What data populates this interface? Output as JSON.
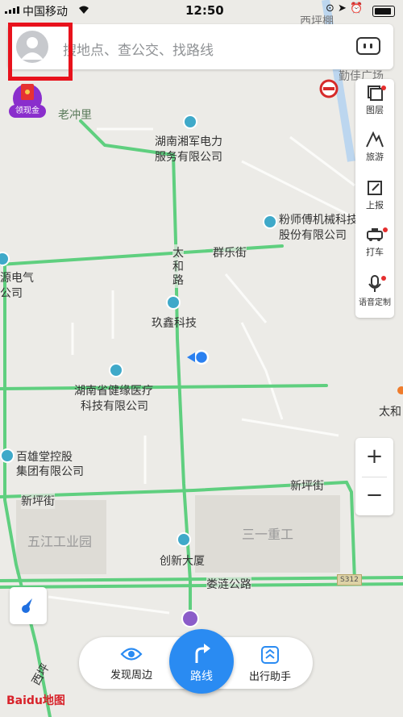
{
  "status_bar": {
    "carrier": "中国移动",
    "time": "12:50"
  },
  "search": {
    "placeholder": "搜地点、查公交、找路线"
  },
  "promo": {
    "label": "领现金"
  },
  "side_panel": {
    "items": [
      {
        "label": "图层",
        "icon": "layers-icon"
      },
      {
        "label": "旅游",
        "icon": "travel-icon"
      },
      {
        "label": "上报",
        "icon": "report-icon"
      },
      {
        "label": "打车",
        "icon": "taxi-icon"
      },
      {
        "label": "语音定制",
        "icon": "mic-icon"
      }
    ]
  },
  "zoom": {
    "in": "+",
    "out": "−"
  },
  "bottom_bar": {
    "discover": "发现周边",
    "route": "路线",
    "assistant": "出行助手"
  },
  "map": {
    "places": [
      {
        "name": "老冲里"
      },
      {
        "name": "湖南湘军电力"
      },
      {
        "name": "服务有限公司"
      },
      {
        "name": "粉师傅机械科技"
      },
      {
        "name": "股份有限公司"
      },
      {
        "name": "源电气"
      },
      {
        "name": "公司"
      },
      {
        "name": "玖鑫科技"
      },
      {
        "name": "湖南省健缘医疗"
      },
      {
        "name": "科技有限公司"
      },
      {
        "name": "百雄堂控股"
      },
      {
        "name": "集团有限公司"
      },
      {
        "name": "五江工业园"
      },
      {
        "name": "三一重工"
      },
      {
        "name": "创新大厦"
      },
      {
        "name": "太和"
      },
      {
        "name": "西坪"
      },
      {
        "name": "西坪棚"
      },
      {
        "name": "勤佳广场"
      }
    ],
    "roads": [
      {
        "name": "群乐街"
      },
      {
        "name": "太"
      },
      {
        "name": "和"
      },
      {
        "name": "路"
      },
      {
        "name": "新坪街"
      },
      {
        "name": "新坪街"
      },
      {
        "name": "娄涟公路"
      }
    ],
    "highway_badge": "S312"
  },
  "logo": "Baidu地图"
}
